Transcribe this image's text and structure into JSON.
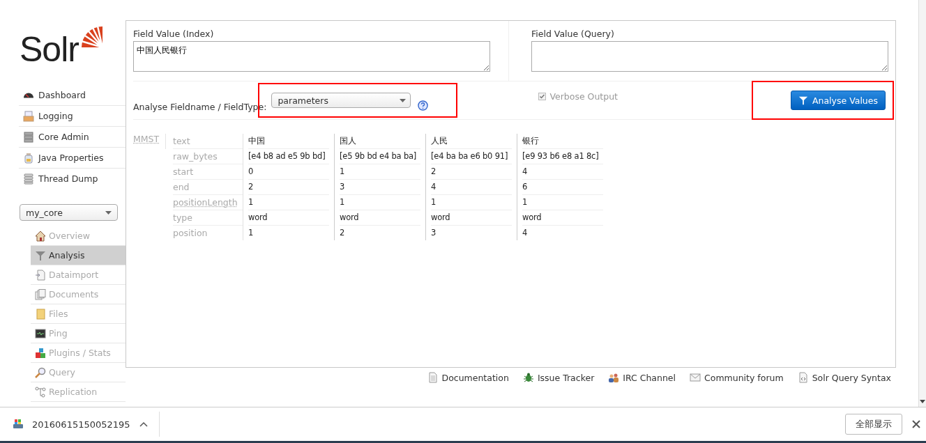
{
  "logo": {
    "text": "Solr"
  },
  "nav": [
    {
      "label": "Dashboard"
    },
    {
      "label": "Logging"
    },
    {
      "label": "Core Admin"
    },
    {
      "label": "Java Properties"
    },
    {
      "label": "Thread Dump"
    }
  ],
  "core_selector": {
    "value": "my_core"
  },
  "core_nav": [
    {
      "label": "Overview",
      "selected": false,
      "disabled": true
    },
    {
      "label": "Analysis",
      "selected": true,
      "disabled": false
    },
    {
      "label": "Dataimport",
      "selected": false,
      "disabled": true
    },
    {
      "label": "Documents",
      "selected": false,
      "disabled": true
    },
    {
      "label": "Files",
      "selected": false,
      "disabled": true
    },
    {
      "label": "Ping",
      "selected": false,
      "disabled": true
    },
    {
      "label": "Plugins / Stats",
      "selected": false,
      "disabled": true
    },
    {
      "label": "Query",
      "selected": false,
      "disabled": true
    },
    {
      "label": "Replication",
      "selected": false,
      "disabled": true
    }
  ],
  "index_field": {
    "label": "Field Value (Index)",
    "value": "中国人民银行"
  },
  "query_field": {
    "label": "Field Value (Query)"
  },
  "fieldtype": {
    "label": "Analyse Fieldname / FieldType:",
    "value": "parameters",
    "highlighted": true
  },
  "verbose": {
    "label": "Verbose Output",
    "checked": true,
    "disabled": true
  },
  "analyse_button": {
    "label": "Analyse Values",
    "highlighted": true
  },
  "analysis": {
    "stage": "MMST",
    "attributes": [
      {
        "label": "text",
        "dotted": false
      },
      {
        "label": "raw_bytes",
        "dotted": false
      },
      {
        "label": "start",
        "dotted": false
      },
      {
        "label": "end",
        "dotted": false
      },
      {
        "label": "positionLength",
        "dotted": true
      },
      {
        "label": "type",
        "dotted": false
      },
      {
        "label": "position",
        "dotted": false
      }
    ],
    "tokens": [
      {
        "values": [
          "中国",
          "[e4 b8 ad e5 9b bd]",
          "0",
          "2",
          "1",
          "word",
          "1"
        ]
      },
      {
        "values": [
          "国人",
          "[e5 9b bd e4 ba ba]",
          "1",
          "3",
          "1",
          "word",
          "2"
        ]
      },
      {
        "values": [
          "人民",
          "[e4 ba ba e6 b0 91]",
          "2",
          "4",
          "1",
          "word",
          "3"
        ]
      },
      {
        "values": [
          "银行",
          "[e9 93 b6 e8 a1 8c]",
          "4",
          "6",
          "1",
          "word",
          "4"
        ]
      }
    ]
  },
  "footer_links": [
    {
      "label": "Documentation"
    },
    {
      "label": "Issue Tracker"
    },
    {
      "label": "IRC Channel"
    },
    {
      "label": "Community forum"
    },
    {
      "label": "Solr Query Syntax"
    }
  ],
  "download_bar": {
    "file": "20160615150052195",
    "show_all": "全部显示"
  }
}
